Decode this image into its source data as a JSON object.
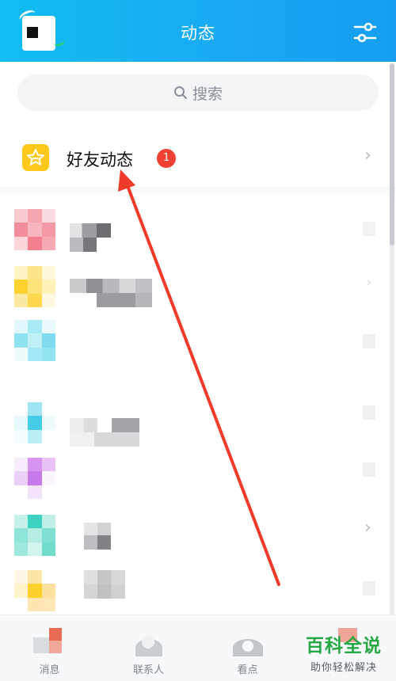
{
  "header": {
    "title": "动态"
  },
  "search": {
    "placeholder": "搜索"
  },
  "friends": {
    "label": "好友动态",
    "badge_count": "1"
  },
  "tabs": [
    {
      "label": "消息"
    },
    {
      "label": "联系人"
    },
    {
      "label": "看点"
    },
    {
      "label": ""
    }
  ],
  "watermark": {
    "title": "百科全说",
    "subtitle": "助你轻松解决"
  },
  "colors": {
    "header_blue": "#1aa8f3",
    "badge_red": "#f04134",
    "star_yellow": "#ffc81a",
    "arrow_red": "#f03a2a",
    "watermark_green": "#25a844"
  }
}
